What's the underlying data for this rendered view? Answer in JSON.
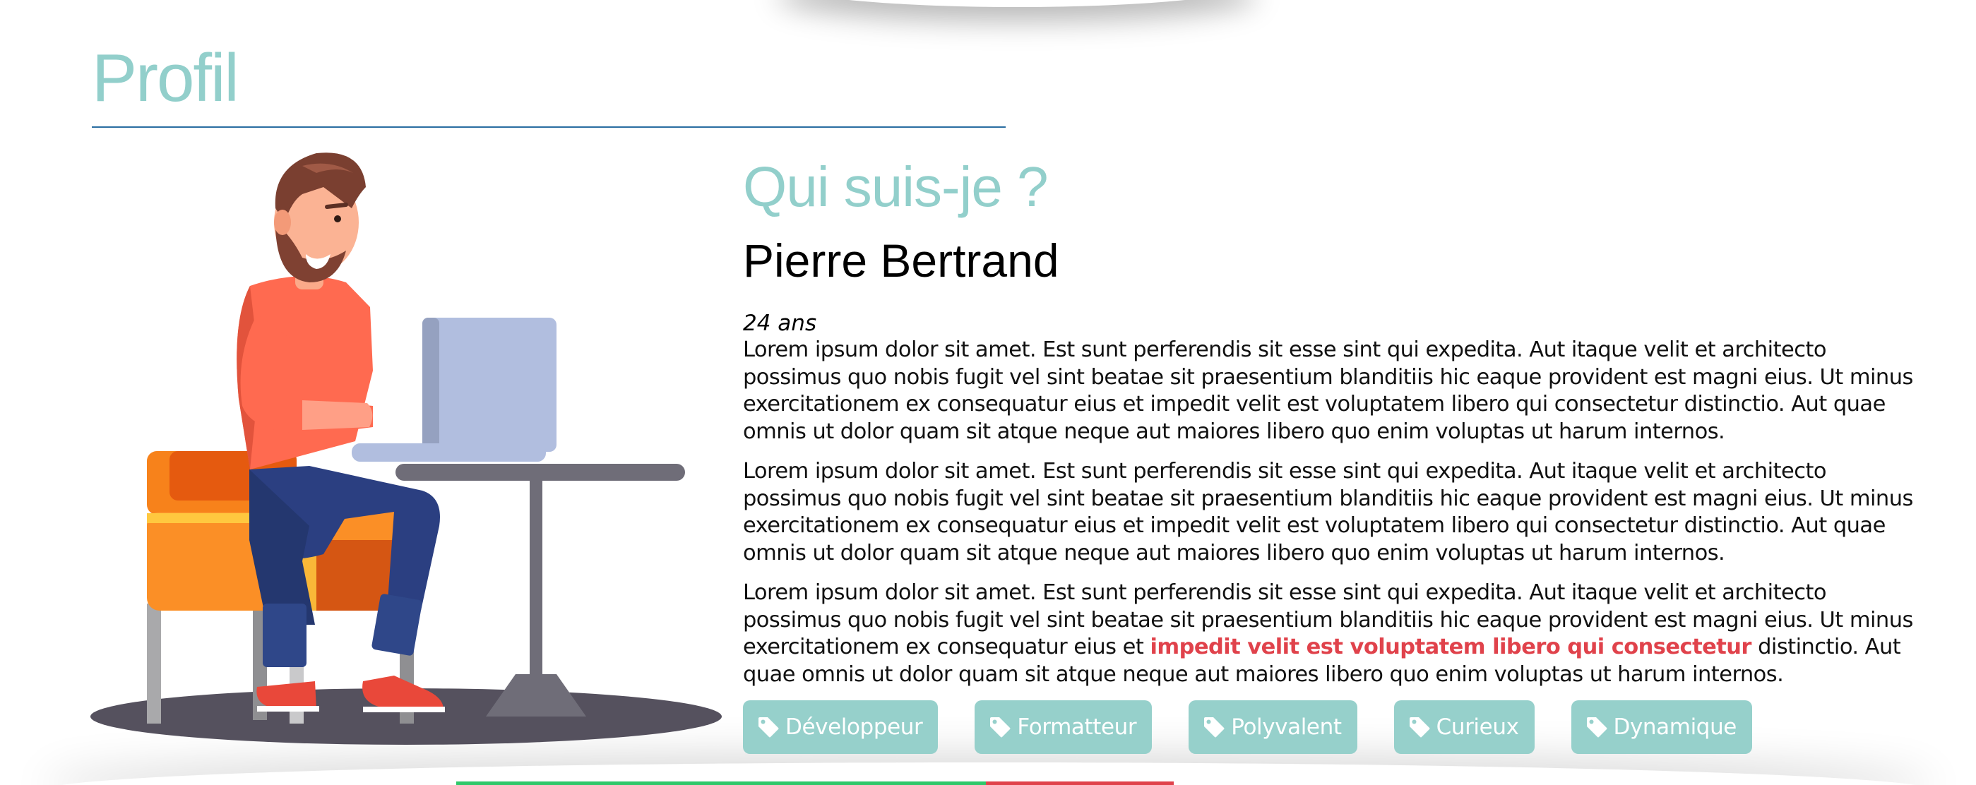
{
  "section": {
    "title": "Profil"
  },
  "about": {
    "heading": "Qui suis-je ?",
    "name": "Pierre Bertrand",
    "age": "24 ans",
    "paragraphs": [
      "Lorem ipsum dolor sit amet. Est sunt perferendis sit esse sint qui expedita. Aut itaque velit et architecto possimus quo nobis fugit vel sint beatae sit praesentium blanditiis hic eaque provident est magni eius. Ut minus exercitationem ex consequatur eius et impedit velit est voluptatem libero qui consectetur distinctio. Aut quae omnis ut dolor quam sit atque neque aut maiores libero quo enim voluptas ut harum internos.",
      "Lorem ipsum dolor sit amet. Est sunt perferendis sit esse sint qui expedita. Aut itaque velit et architecto possimus quo nobis fugit vel sint beatae sit praesentium blanditiis hic eaque provident est magni eius. Ut minus exercitationem ex consequatur eius et impedit velit est voluptatem libero qui consectetur distinctio. Aut quae omnis ut dolor quam sit atque neque aut maiores libero quo enim voluptas ut harum internos."
    ],
    "last_paragraph": {
      "before": "Lorem ipsum dolor sit amet. Est sunt perferendis sit esse sint qui expedita. Aut itaque velit et architecto possimus quo nobis fugit vel sint beatae sit praesentium blanditiis hic eaque provident est magni eius. Ut minus exercitationem ex consequatur eius et ",
      "highlight": "impedit velit est voluptatem libero qui consectetur",
      "after": " distinctio. Aut quae omnis ut dolor quam sit atque neque aut maiores libero quo enim voluptas ut harum internos."
    }
  },
  "tags": [
    {
      "label": "Développeur",
      "icon": "tag-icon"
    },
    {
      "label": "Formatteur",
      "icon": "tag-icon"
    },
    {
      "label": "Polyvalent",
      "icon": "tag-icon"
    },
    {
      "label": "Curieux",
      "icon": "tag-icon"
    },
    {
      "label": "Dynamique",
      "icon": "tag-icon"
    }
  ],
  "illustration": {
    "icon": "man-working-at-laptop-illustration"
  },
  "colors": {
    "accent": "#92cfcb",
    "tag_bg": "#96d0cb",
    "rule": "#2a6da1",
    "highlight": "#e0424b",
    "progress_green": "#2fc86a",
    "progress_red": "#e0424b"
  }
}
